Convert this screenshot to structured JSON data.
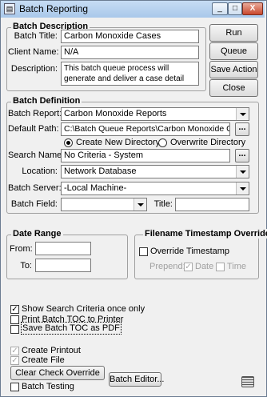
{
  "window": {
    "title": "Batch Reporting",
    "minimize_label": "_",
    "maximize_label": "□",
    "close_label": "X"
  },
  "batch_description": {
    "group_title": "Batch Description",
    "batch_title_label": "Batch Title:",
    "batch_title_value": "Carbon Monoxide Cases",
    "client_name_label": "Client Name:",
    "client_name_value": "N/A",
    "description_label": "Description:",
    "description_value": "This batch queue process will generate and deliver a case detail report for all CO cases"
  },
  "actions": {
    "run_label": "Run",
    "queue_label": "Queue",
    "save_action_label": "Save Action",
    "close_label": "Close"
  },
  "batch_definition": {
    "group_title": "Batch Definition",
    "batch_report_label": "Batch Report:",
    "batch_report_value": "Carbon Monoxide Reports",
    "default_path_label": "Default Path:",
    "default_path_value": "C:\\Batch Queue Reports\\Carbon Monoxide Cases",
    "browse_label": "...",
    "create_new_directory_label": "Create New Directory",
    "overwrite_directory_label": "Overwrite Directory",
    "search_name_label": "Search Name:",
    "search_name_value": "No Criteria - System",
    "location_label": "Location:",
    "location_value": "Network Database",
    "batch_server_label": "Batch Server:",
    "batch_server_value": "-Local Machine-",
    "batch_field_label": "Batch Field:",
    "batch_field_value": "",
    "title_label": "Title:",
    "title_value": ""
  },
  "date_range": {
    "group_title": "Date Range",
    "from_label": "From:",
    "to_label": "To:",
    "from_value": "",
    "to_value": ""
  },
  "filename_timestamp": {
    "group_title": "Filename Timestamp Override",
    "override_label": "Override Timestamp",
    "prepend_label": "Prepend:",
    "date_label": "Date",
    "time_label": "Time"
  },
  "options": {
    "show_search_criteria_label": "Show Search Criteria once only",
    "print_batch_toc_label": "Print Batch TOC to Printer",
    "save_batch_toc_pdf_label": "Save Batch TOC as PDF",
    "create_printout_label": "Create Printout",
    "create_file_label": "Create File",
    "clear_check_override_label": "Clear Check Override",
    "batch_editor_label": "Batch Editor...",
    "batch_testing_label": "Batch Testing",
    "check_mark": "✓"
  }
}
